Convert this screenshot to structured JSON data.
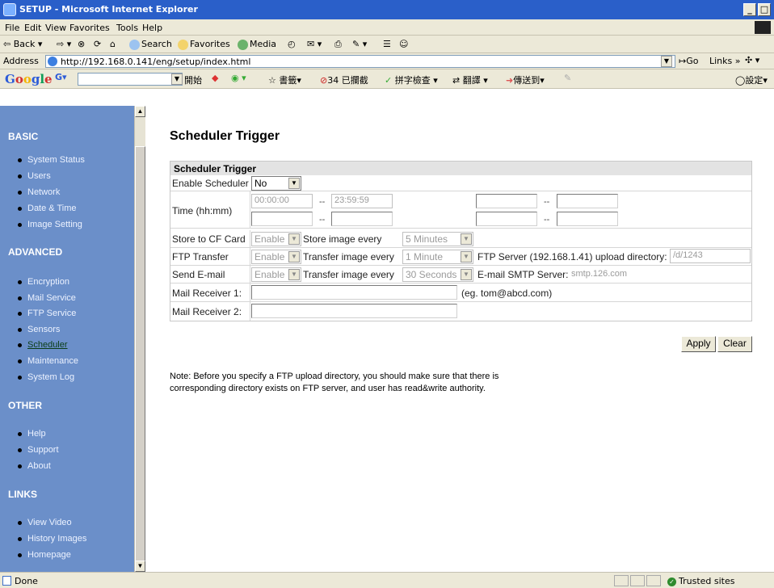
{
  "window": {
    "title": "SETUP - Microsoft Internet Explorer",
    "buttons": {
      "minimize": "_",
      "maximize": "□",
      "close": "x"
    }
  },
  "menu": [
    "File",
    "Edit",
    "View",
    "Favorites",
    "Tools",
    "Help"
  ],
  "toolbar": {
    "back": "Back",
    "search": "Search",
    "favorites": "Favorites",
    "media": "Media"
  },
  "address": {
    "label": "Address",
    "url": "http://192.168.0.141/eng/setup/index.html",
    "go": "Go",
    "links": "Links"
  },
  "googlebar": {
    "logo": [
      "G",
      "o",
      "o",
      "g",
      "l",
      "e"
    ],
    "start": "開始",
    "bookmarks": "書籤",
    "blocked": "34 已攔截",
    "spellcheck": "拼字檢查",
    "translate": "翻譯",
    "sendto": "傳送到",
    "settings": "設定"
  },
  "sidebar": {
    "sections": [
      {
        "title": "BASIC",
        "items": [
          "System Status",
          "Users",
          "Network",
          "Date & Time",
          "Image Setting"
        ]
      },
      {
        "title": "ADVANCED",
        "items": [
          "Encryption",
          "Mail Service",
          "FTP Service",
          "Sensors",
          "Scheduler",
          "Maintenance",
          "System Log"
        ]
      },
      {
        "title": "OTHER",
        "items": [
          "Help",
          "Support",
          "About"
        ]
      },
      {
        "title": "LINKS",
        "items": [
          "View Video",
          "History Images",
          "Homepage"
        ]
      }
    ],
    "active_item": "Scheduler"
  },
  "page": {
    "heading": "Scheduler Trigger",
    "table_title": "Scheduler Trigger",
    "enable_scheduler": {
      "label": "Enable Scheduler",
      "value": "No"
    },
    "time": {
      "label": "Time (hh:mm)",
      "range_sep": "--",
      "slots": [
        "00:00:00",
        "23:59:59",
        "",
        "",
        "",
        "",
        "",
        ""
      ]
    },
    "store_cf": {
      "label": "Store to CF Card",
      "value": "Enable",
      "every_label": "Store image every",
      "every_value": "5 Minutes"
    },
    "ftp": {
      "label": "FTP Transfer",
      "value": "Enable",
      "every_label": "Transfer image every",
      "every_value": "1 Minute",
      "server_label": "FTP Server (192.168.1.41) upload directory:",
      "directory": "/d/1243"
    },
    "email": {
      "label": "Send E-mail",
      "value": "Enable",
      "every_label": "Transfer image every",
      "every_value": "30 Seconds",
      "smtp_label": "E-mail SMTP Server:",
      "smtp_value": "smtp.126.com"
    },
    "mail_receiver_1": {
      "label": "Mail Receiver 1:",
      "value": "",
      "hint": "(eg. tom@abcd.com)"
    },
    "mail_receiver_2": {
      "label": "Mail Receiver 2:",
      "value": ""
    },
    "buttons": {
      "apply": "Apply",
      "clear": "Clear"
    },
    "note_lines": [
      "Note: Before you specify a FTP upload directory, you should make sure that there is",
      "corresponding directory exists on FTP server, and user has read&write authority."
    ]
  },
  "status": {
    "done": "Done",
    "zone": "Trusted sites"
  }
}
